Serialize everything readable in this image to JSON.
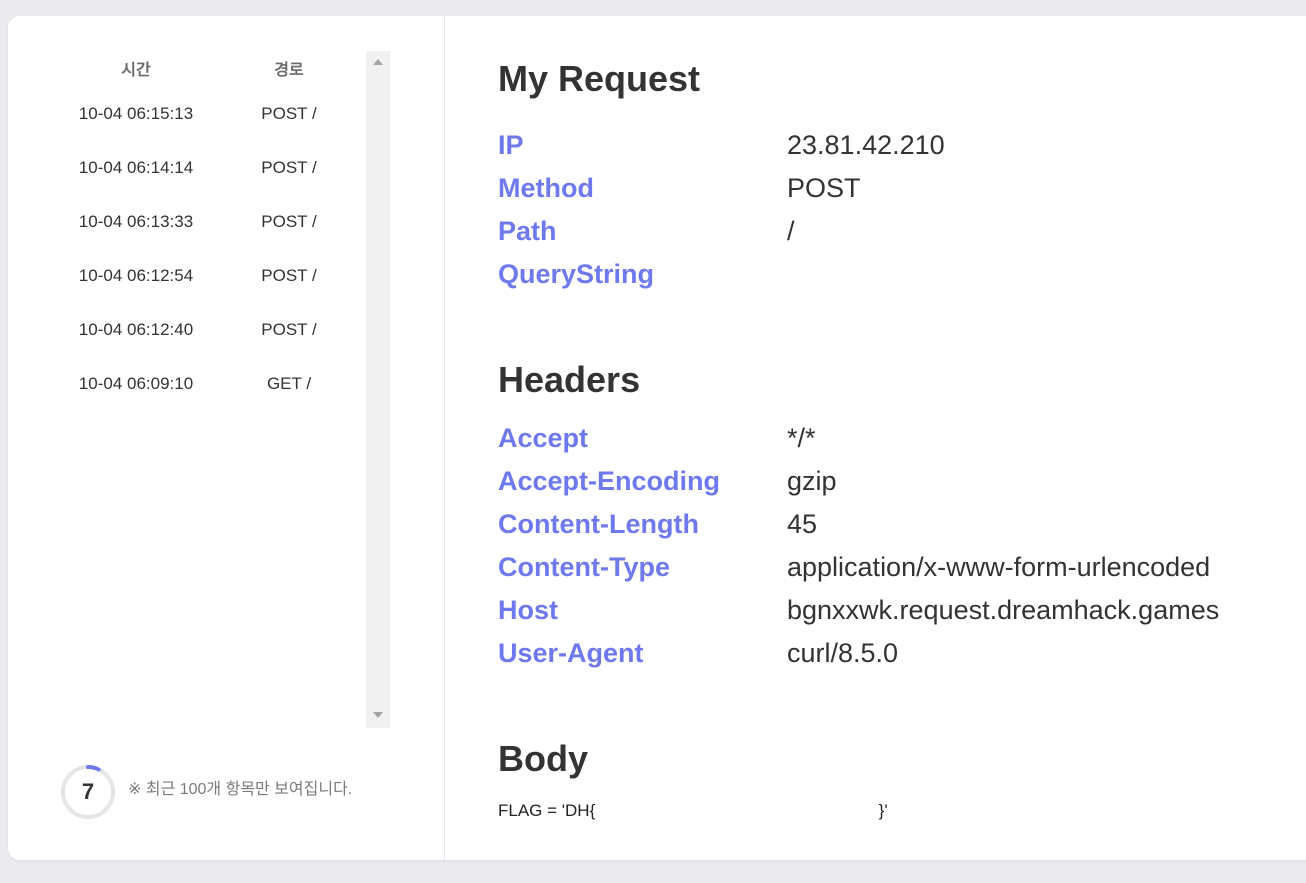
{
  "sidebar": {
    "header": {
      "time": "시간",
      "path": "경로"
    },
    "requests": [
      {
        "time": "10-04 06:15:13",
        "path": "POST /"
      },
      {
        "time": "10-04 06:14:14",
        "path": "POST /"
      },
      {
        "time": "10-04 06:13:33",
        "path": "POST /"
      },
      {
        "time": "10-04 06:12:54",
        "path": "POST /"
      },
      {
        "time": "10-04 06:12:40",
        "path": "POST /"
      },
      {
        "time": "10-04 06:09:10",
        "path": "GET /"
      }
    ],
    "counter": "7",
    "counter_progress": 0.07,
    "note": "※ 최근 100개 항목만 보여집니다."
  },
  "request": {
    "title": "My Request",
    "fields": [
      {
        "key": "IP",
        "value": "23.81.42.210"
      },
      {
        "key": "Method",
        "value": "POST"
      },
      {
        "key": "Path",
        "value": "/"
      },
      {
        "key": "QueryString",
        "value": ""
      }
    ]
  },
  "headers": {
    "title": "Headers",
    "fields": [
      {
        "key": "Accept",
        "value": "*/*"
      },
      {
        "key": "Accept-Encoding",
        "value": "gzip"
      },
      {
        "key": "Content-Length",
        "value": "45"
      },
      {
        "key": "Content-Type",
        "value": "application/x-www-form-urlencoded"
      },
      {
        "key": "Host",
        "value": "bgnxxwk.request.dreamhack.games"
      },
      {
        "key": "User-Agent",
        "value": "curl/8.5.0"
      }
    ]
  },
  "body": {
    "title": "Body",
    "content": "FLAG = 'DH{                                                            }'"
  },
  "colors": {
    "accent": "#6f79ee",
    "text": "#333333",
    "muted": "#7a7a7a"
  }
}
